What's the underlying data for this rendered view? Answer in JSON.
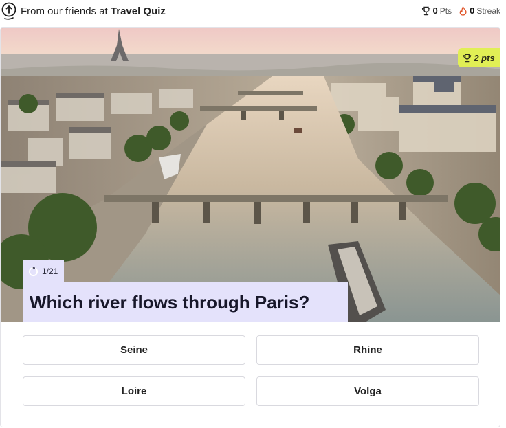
{
  "header": {
    "brand_prefix": "From our friends at ",
    "brand_name": "Travel Quiz",
    "points_value": "0",
    "points_label": "Pts",
    "streak_value": "0",
    "streak_label": "Streak"
  },
  "quiz": {
    "points_badge": "2 pts",
    "counter": "1/21",
    "progress_fraction": 0.048,
    "question": "Which river flows through Paris?",
    "answers": [
      "Seine",
      "Rhine",
      "Loire",
      "Volga"
    ]
  },
  "colors": {
    "question_bg": "#e4e2fb",
    "points_badge_bg": "#e1ef55",
    "answer_border": "#d9d9df"
  },
  "icons": {
    "logo": "upload-arrow-circle-icon",
    "points": "trophy-icon",
    "streak": "flame-icon",
    "counter": "progress-ring-icon"
  }
}
